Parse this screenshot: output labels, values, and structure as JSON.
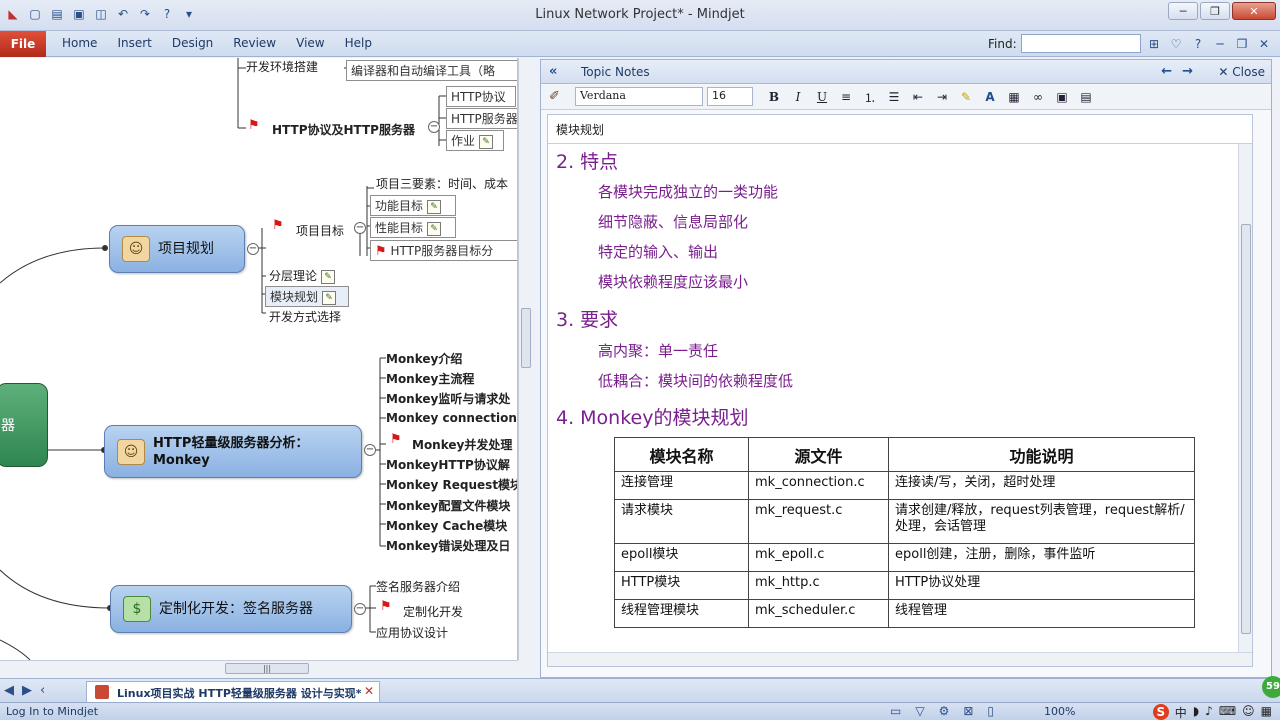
{
  "window": {
    "title": "Linux Network Project* - Mindjet"
  },
  "ribbon": {
    "file_label": "File",
    "tabs": [
      "Home",
      "Insert",
      "Design",
      "Review",
      "View",
      "Help"
    ],
    "find_label": "Find:",
    "find_value": ""
  },
  "map": {
    "env_topic": "开发环境搭建",
    "env_sub": "编译器和自动编译工具（略",
    "http_topic": "HTTP协议及HTTP服务器",
    "http_subs": [
      "HTTP协议",
      "HTTP服务器",
      "作业"
    ],
    "plan_node": "项目规划",
    "goal_topic": "项目目标",
    "goal_subs": [
      "项目三要素：时间、成本",
      "功能目标",
      "性能目标",
      "HTTP服务器目标分"
    ],
    "plan_subs": [
      "分层理论",
      "模块规划",
      "开发方式选择"
    ],
    "green_node_text": "器",
    "monkey_node": "HTTP轻量级服务器分析：Monkey",
    "monkey_subs": [
      "Monkey介绍",
      "Monkey主流程",
      "Monkey监听与请求处",
      "Monkey connection",
      "Monkey并发处理",
      "MonkeyHTTP协议解",
      "Monkey Request模块",
      "Monkey配置文件模块",
      "Monkey Cache模块",
      "Monkey错误处理及日"
    ],
    "custom_node": "定制化开发：签名服务器",
    "custom_subs": [
      "签名服务器介绍",
      "定制化开发",
      "应用协议设计"
    ]
  },
  "notes": {
    "header_label": "Topic Notes",
    "close_label": "Close",
    "font_name": "Verdana",
    "font_size": "16",
    "doc_title": "模块规划",
    "sec2_heading": "2. 特点",
    "sec2_items": [
      "各模块完成独立的一类功能",
      "细节隐蔽、信息局部化",
      "特定的输入、输出",
      "模块依赖程度应该最小"
    ],
    "sec3_heading": "3. 要求",
    "sec3_items": [
      "高内聚：单一责任",
      "低耦合：模块间的依赖程度低"
    ],
    "sec4_heading": "4. Monkey的模块规划",
    "table_headers": [
      "模块名称",
      "源文件",
      "功能说明"
    ],
    "table_rows": [
      [
        "连接管理",
        "mk_connection.c",
        "连接读/写，关闭，超时处理"
      ],
      [
        "请求模块",
        "mk_request.c",
        "请求创建/释放，request列表管理，request解析/处理，会话管理"
      ],
      [
        "epoll模块",
        "mk_epoll.c",
        "epoll创建，注册，删除，事件监听"
      ],
      [
        "HTTP模块",
        "mk_http.c",
        "HTTP协议处理"
      ],
      [
        "线程管理模块",
        "mk_scheduler.c",
        "线程管理"
      ]
    ]
  },
  "doctab": {
    "label": "Linux项目实战 HTTP轻量级服务器 设计与实现*"
  },
  "status": {
    "login": "Log In to Mindjet",
    "zoom": "100%",
    "badge": "59"
  }
}
